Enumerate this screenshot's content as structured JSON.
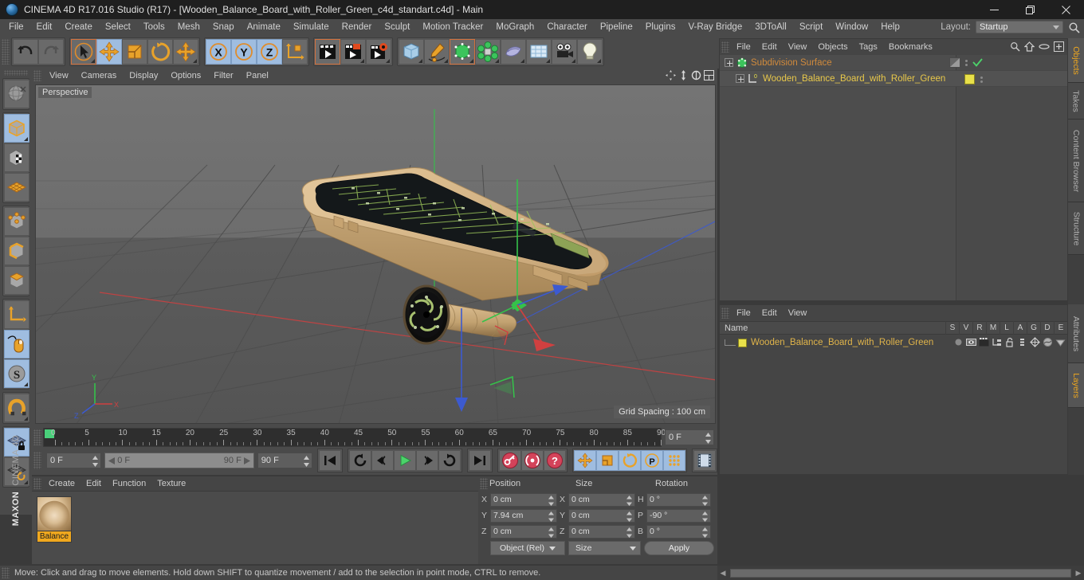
{
  "window": {
    "title": "CINEMA 4D R17.016 Studio (R17) - [Wooden_Balance_Board_with_Roller_Green_c4d_standart.c4d] - Main",
    "minimize": "–",
    "maximize": "❐",
    "close": "✕"
  },
  "menubar": {
    "items": [
      {
        "label": "File"
      },
      {
        "label": "Edit"
      },
      {
        "label": "Create"
      },
      {
        "label": "Select"
      },
      {
        "label": "Tools"
      },
      {
        "label": "Mesh"
      },
      {
        "label": "Snap"
      },
      {
        "label": "Animate"
      },
      {
        "label": "Simulate"
      },
      {
        "label": "Render"
      },
      {
        "label": "Sculpt"
      },
      {
        "label": "Motion Tracker"
      },
      {
        "label": "MoGraph"
      },
      {
        "label": "Character"
      },
      {
        "label": "Pipeline"
      },
      {
        "label": "Plugins"
      },
      {
        "label": "V-Ray Bridge"
      },
      {
        "label": "3DToAll"
      },
      {
        "label": "Script"
      },
      {
        "label": "Window"
      },
      {
        "label": "Help"
      }
    ],
    "layout_label": "Layout:",
    "layout_value": "Startup"
  },
  "viewport": {
    "menu": [
      "View",
      "Cameras",
      "Display",
      "Options",
      "Filter",
      "Panel"
    ],
    "label": "Perspective",
    "grid_spacing": "Grid Spacing : 100 cm"
  },
  "timeline": {
    "ticks": [
      "0",
      "5",
      "10",
      "15",
      "20",
      "25",
      "30",
      "35",
      "40",
      "45",
      "50",
      "55",
      "60",
      "65",
      "70",
      "75",
      "80",
      "85",
      "90"
    ],
    "current_frame": "0 F",
    "range_start": "0 F",
    "range_end": "90 F",
    "end_frame": "90 F",
    "preview_frame": "0 F"
  },
  "material_manager": {
    "menu": [
      "Create",
      "Edit",
      "Function",
      "Texture"
    ],
    "materials": [
      {
        "name": "Balance"
      }
    ]
  },
  "coordinates": {
    "headers": [
      "Position",
      "Size",
      "Rotation"
    ],
    "position": {
      "x_label": "X",
      "x": "0 cm",
      "y_label": "Y",
      "y": "7.94 cm",
      "z_label": "Z",
      "z": "0 cm"
    },
    "size": {
      "x_label": "X",
      "x": "0 cm",
      "y_label": "Y",
      "y": "0 cm",
      "z_label": "Z",
      "z": "0 cm"
    },
    "rotation": {
      "h_label": "H",
      "h": "0 °",
      "p_label": "P",
      "p": "-90 °",
      "b_label": "B",
      "b": "0 °"
    },
    "mode_dropdown": "Object (Rel)",
    "size_dropdown": "Size",
    "apply_button": "Apply"
  },
  "object_manager": {
    "menu": [
      "File",
      "Edit",
      "View",
      "Objects",
      "Tags",
      "Bookmarks"
    ],
    "rows": [
      {
        "name": "Subdivision Surface",
        "level": 0,
        "color": "#d08a3c",
        "tag": "check"
      },
      {
        "name": "Wooden_Balance_Board_with_Roller_Green",
        "level": 1,
        "color": "#e8c84a",
        "tag": "yellow"
      }
    ]
  },
  "layer_manager": {
    "menu": [
      "File",
      "Edit",
      "View"
    ],
    "columns": [
      "Name",
      "S",
      "V",
      "R",
      "M",
      "L",
      "A",
      "G",
      "D",
      "E"
    ],
    "rows": [
      {
        "name": "Wooden_Balance_Board_with_Roller_Green",
        "swatch": "#e8e04a"
      }
    ]
  },
  "right_tabs": {
    "top": [
      "Objects",
      "Takes",
      "Content Browser",
      "Structure"
    ],
    "bottom": [
      "Attributes",
      "Layers"
    ],
    "active_top": "Objects",
    "active_bottom": "Layers"
  },
  "statusbar": {
    "message": "Move: Click and drag to move elements. Hold down SHIFT to quantize movement / add to the selection in point mode, CTRL to remove."
  },
  "branding": {
    "maxon": "MAXON",
    "product": "CINEMA 4D"
  },
  "colors": {
    "accent_orange": "#e08c2a",
    "active_blue": "#9fbde0",
    "panel_bg": "#4a4a4a",
    "text": "#c8c8c8",
    "highlight_yellow": "#f0a81e"
  }
}
